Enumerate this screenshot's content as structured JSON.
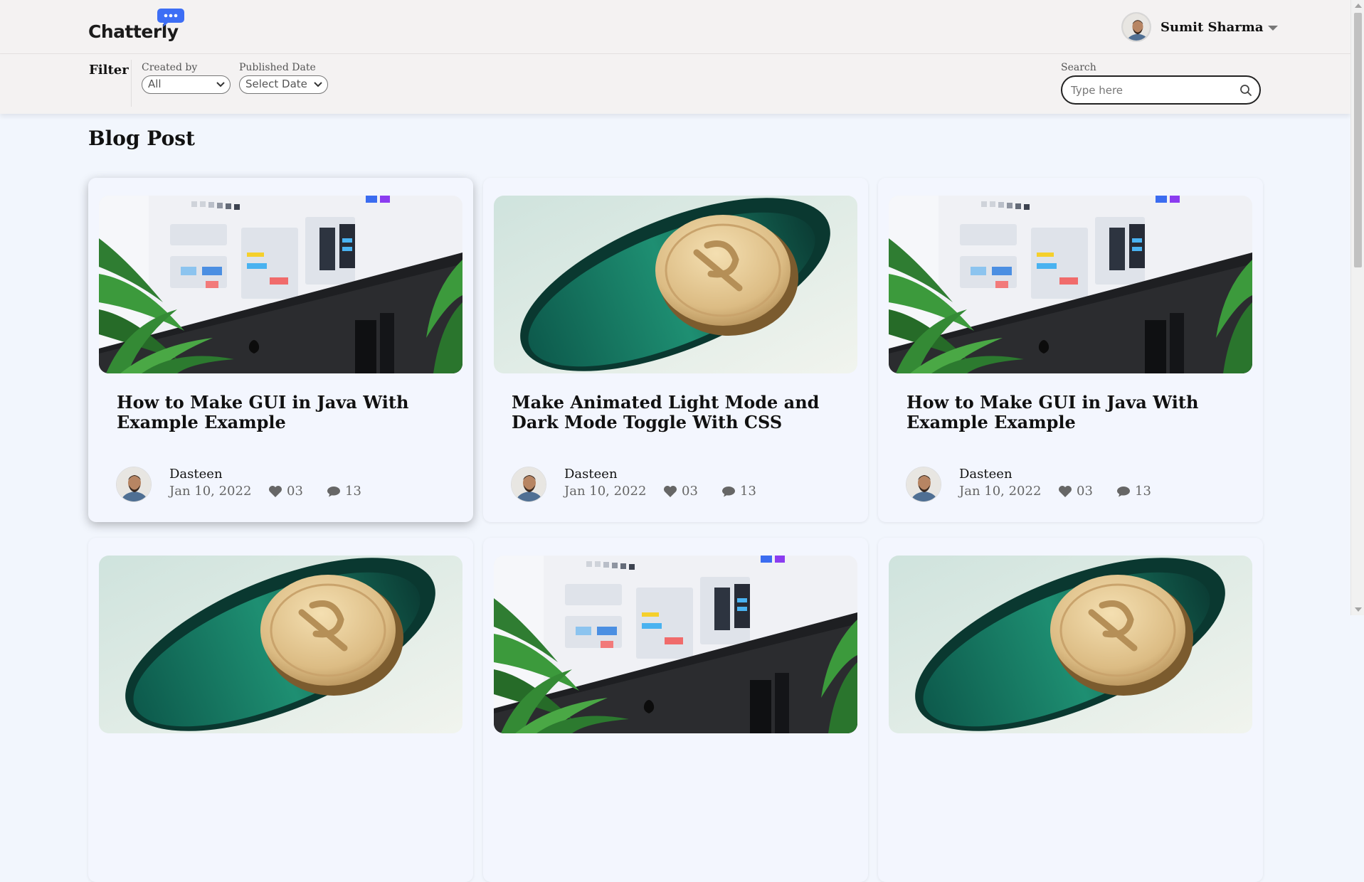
{
  "app": {
    "name": "Chatterly"
  },
  "user": {
    "name": "Sumit Sharma"
  },
  "filters": {
    "title": "Filter",
    "created_by": {
      "label": "Created by",
      "value": "All"
    },
    "published_date": {
      "label": "Published Date",
      "value": "Select Date"
    },
    "search": {
      "label": "Search",
      "placeholder": "Type here"
    }
  },
  "main": {
    "title": "Blog Post",
    "posts": [
      {
        "title": "How to Make GUI in Java With Example Example",
        "author": "Dasteen",
        "date": "Jan 10, 2022",
        "likes": "03",
        "comments": "13",
        "image": "desktop-ui"
      },
      {
        "title": "Make Animated Light Mode and Dark Mode Toggle With CSS",
        "author": "Dasteen",
        "date": "Jan 10, 2022",
        "likes": "03",
        "comments": "13",
        "image": "coin-toggle"
      },
      {
        "title": "How to Make GUI in Java With Example Example",
        "author": "Dasteen",
        "date": "Jan 10, 2022",
        "likes": "03",
        "comments": "13",
        "image": "desktop-ui"
      },
      {
        "image": "coin-toggle"
      },
      {
        "image": "desktop-ui"
      },
      {
        "image": "coin-toggle"
      }
    ]
  },
  "colors": {
    "logo_accent": "#3d6ef5",
    "page_bg": "#f2f6fd",
    "header_bg": "#f4f2f2"
  },
  "icons": [
    "chat-bubble-logo-icon",
    "caret-down-icon",
    "chevron-down-icon",
    "search-icon",
    "heart-icon",
    "comment-icon"
  ]
}
